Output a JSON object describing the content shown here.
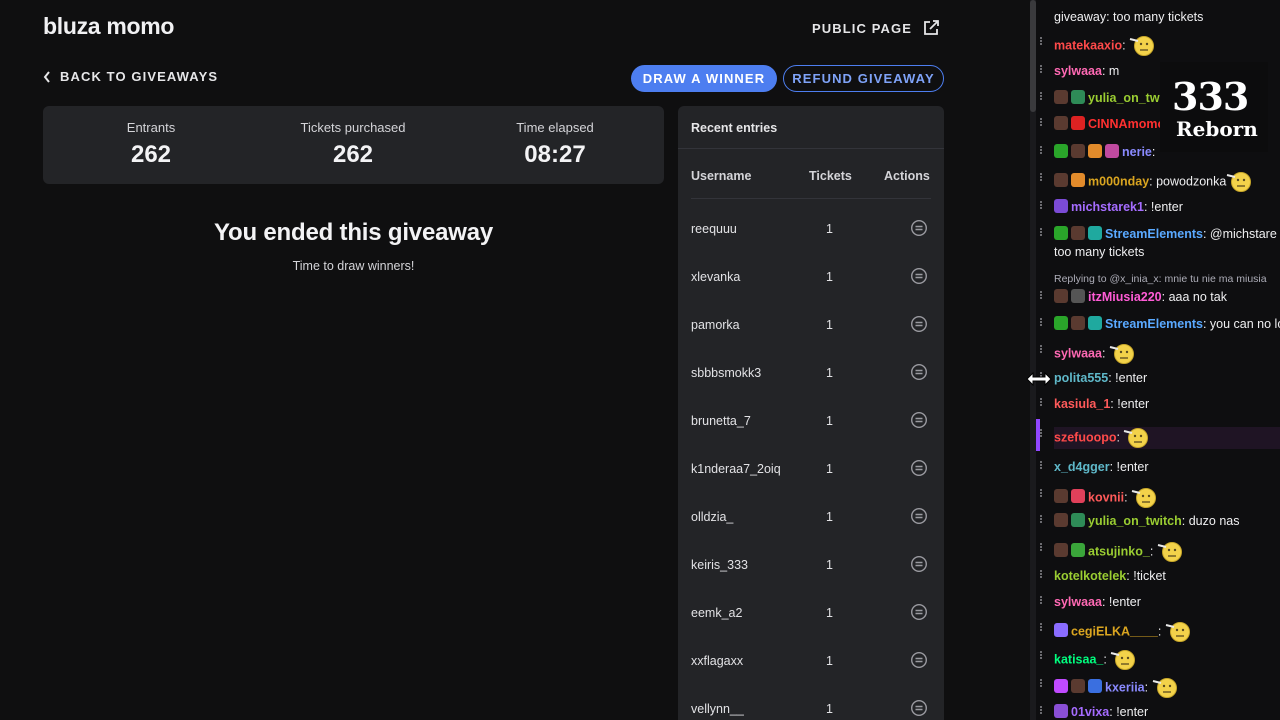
{
  "app": {
    "title": "bluza momo",
    "public_page_label": "PUBLIC PAGE",
    "back_label": "BACK TO GIVEAWAYS",
    "draw_winner_label": "DRAW A WINNER",
    "refund_label": "REFUND GIVEAWAY",
    "accent_color": "#4d7ef0"
  },
  "stats": {
    "entrants_label": "Entrants",
    "entrants_value": "262",
    "tickets_label": "Tickets purchased",
    "tickets_value": "262",
    "time_label": "Time elapsed",
    "time_value": "08:27"
  },
  "status": {
    "heading": "You ended this giveaway",
    "subtext": "Time to draw winners!"
  },
  "recent": {
    "title": "Recent entries",
    "columns": [
      "Username",
      "Tickets",
      "Actions"
    ],
    "rows": [
      {
        "username": "reequuu",
        "tickets": "1"
      },
      {
        "username": "xlevanka",
        "tickets": "1"
      },
      {
        "username": "pamorka",
        "tickets": "1"
      },
      {
        "username": "sbbbsmokk3",
        "tickets": "1"
      },
      {
        "username": "brunetta_7",
        "tickets": "1"
      },
      {
        "username": "k1nderaa7_2oiq",
        "tickets": "1"
      },
      {
        "username": "olldzia_",
        "tickets": "1"
      },
      {
        "username": "keiris_333",
        "tickets": "1"
      },
      {
        "username": "eemk_a2",
        "tickets": "1"
      },
      {
        "username": "xxflagaxx",
        "tickets": "1"
      },
      {
        "username": "vellynn__",
        "tickets": "1"
      }
    ]
  },
  "overlay": {
    "number": "333",
    "word": "Reborn"
  },
  "chat": {
    "messages": [
      {
        "user": "",
        "color": "#efeff1",
        "text": "giveaway: too many tickets",
        "badges": [],
        "emote": false
      },
      {
        "user": "matekaaxio",
        "color": "#ff4a4a",
        "text": "",
        "badges": [],
        "emote": true
      },
      {
        "user": "sylwaaa",
        "color": "#ff69b4",
        "text": "m",
        "badges": [],
        "emote": false
      },
      {
        "user": "yulia_on_tw",
        "color": "#9acd32",
        "text": "",
        "badges": [
          "#5a3a30",
          "#2e8b57"
        ],
        "emote": false
      },
      {
        "user": "CINNAmomo",
        "color": "#ff3030",
        "text": "",
        "badges": [
          "#5a3a30",
          "#d22"
        ],
        "emote": false
      },
      {
        "user": "nerie",
        "color": "#8a8aff",
        "text": "",
        "badges": [
          "#2aa52a",
          "#5a3a30",
          "#e28b2b",
          "#c04aa0"
        ],
        "emote": false
      },
      {
        "user": "m000nday",
        "color": "#daa520",
        "text": "powodzonka",
        "badges": [
          "#5a3a30",
          "#e28b2b"
        ],
        "emote": true
      },
      {
        "user": "michstarek1",
        "color": "#a56cff",
        "text": "!enter",
        "badges": [
          "#7b4bd6"
        ],
        "emote": false
      },
      {
        "user": "StreamElements",
        "color": "#5aa9ff",
        "text": "@michstare",
        "badges": [
          "#2aa52a",
          "#5a3a30",
          "#1fa99f"
        ],
        "emote": false
      },
      {
        "user": "",
        "color": "#efeff1",
        "text": "too many tickets",
        "badges": [],
        "emote": false
      },
      {
        "user": "",
        "color": "#adadb8",
        "text": "Replying to @x_inia_x: mnie tu nie ma miusia",
        "badges": [],
        "emote": false,
        "reply": true
      },
      {
        "user": "itzMiusia220",
        "color": "#ff5cd6",
        "text": "aaa no tak",
        "badges": [
          "#5a3a30",
          "#555"
        ],
        "emote": false
      },
      {
        "user": "StreamElements",
        "color": "#5aa9ff",
        "text": "you can no lo",
        "badges": [
          "#2aa52a",
          "#5a3a30",
          "#1fa99f"
        ],
        "emote": false
      },
      {
        "user": "sylwaaa",
        "color": "#ff69b4",
        "text": "",
        "badges": [],
        "emote": true
      },
      {
        "user": "polita555",
        "color": "#5fb8c9",
        "text": "!enter",
        "badges": [],
        "emote": false
      },
      {
        "user": "kasiula_1",
        "color": "#ff5a5a",
        "text": "!enter",
        "badges": [],
        "emote": false
      },
      {
        "user": "szefuoopo",
        "color": "#ff4a4a",
        "text": "",
        "badges": [],
        "emote": true,
        "highlight": true
      },
      {
        "user": "x_d4gger",
        "color": "#5fb8c9",
        "text": "!enter",
        "badges": [],
        "emote": false
      },
      {
        "user": "kovnii",
        "color": "#ff5a5a",
        "text": "",
        "badges": [
          "#5a3a30",
          "#e0405a"
        ],
        "emote": true
      },
      {
        "user": "yulia_on_twitch",
        "color": "#9acd32",
        "text": "duzo nas",
        "badges": [
          "#5a3a30",
          "#2e8b57"
        ],
        "emote": false
      },
      {
        "user": "atsujinko_",
        "color": "#9acd32",
        "text": "",
        "badges": [
          "#5a3a30",
          "#3aa53a"
        ],
        "emote": true
      },
      {
        "user": "kotelkotelek",
        "color": "#9acd32",
        "text": "!ticket",
        "badges": [],
        "emote": false
      },
      {
        "user": "sylwaaa",
        "color": "#ff69b4",
        "text": "!enter",
        "badges": [],
        "emote": false
      },
      {
        "user": "cegiELKA____",
        "color": "#daa520",
        "text": "",
        "badges": [
          "#8a6cff"
        ],
        "emote": true
      },
      {
        "user": "katisaa_",
        "color": "#00ff7f",
        "text": "",
        "badges": [],
        "emote": true
      },
      {
        "user": "kxeriia",
        "color": "#8a8aff",
        "text": "",
        "badges": [
          "#c04aff",
          "#5a3a30",
          "#3a6fe0"
        ],
        "emote": true
      },
      {
        "user": "01vixa",
        "color": "#a56cff",
        "text": "!enter",
        "badges": [
          "#8a4fd6"
        ],
        "emote": false
      }
    ]
  }
}
